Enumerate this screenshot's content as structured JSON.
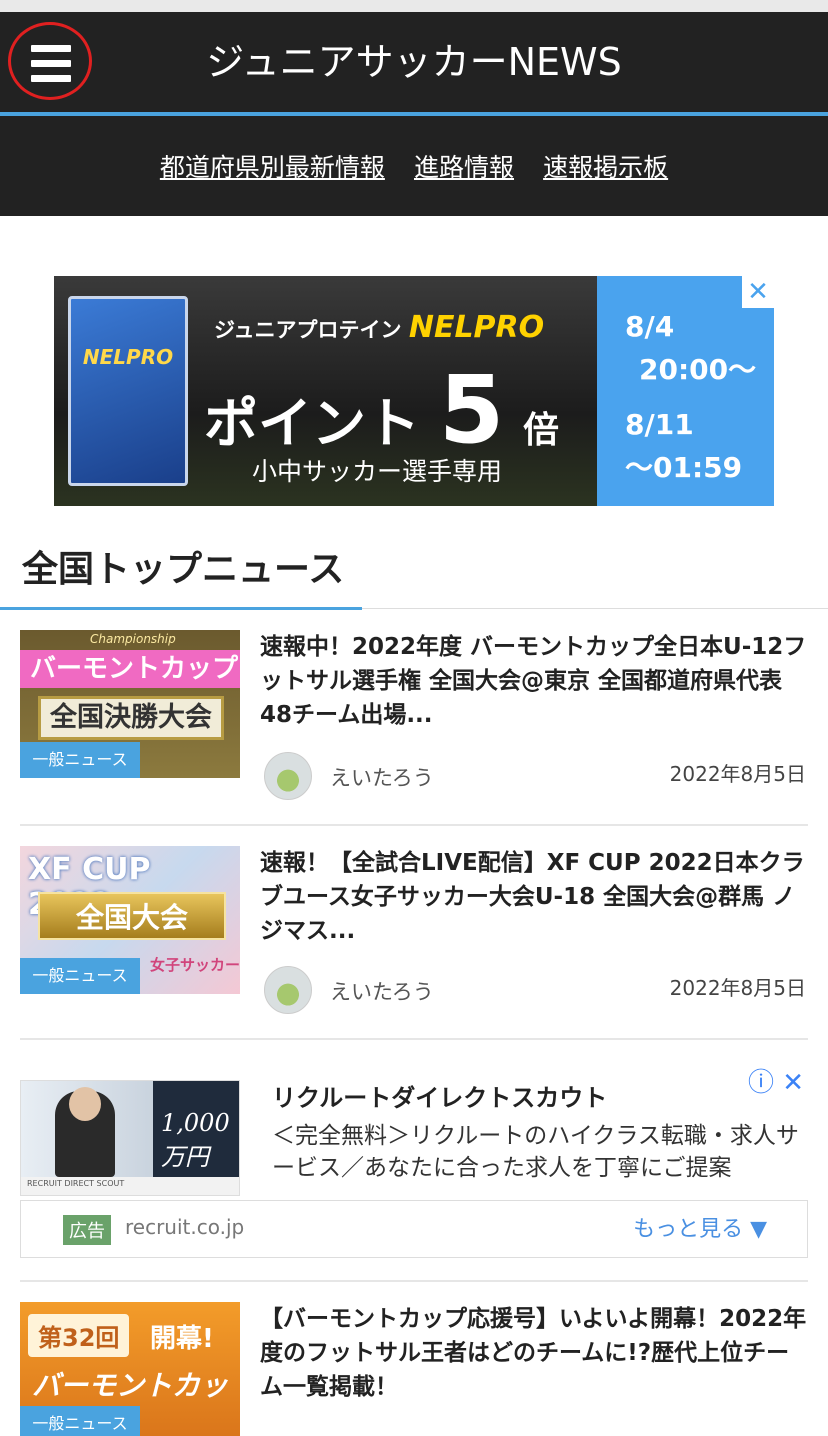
{
  "header": {
    "site_title": "ジュニアサッカーNEWS",
    "subnav": [
      "都道府県別最新情報",
      "進路情報",
      "速報掲示板"
    ]
  },
  "banner": {
    "line1": "ジュニアプロテイン",
    "brand": "NELPRO",
    "pkg_label": "NELPRO",
    "line2a": "ポイント",
    "line2b": "5",
    "line2c": "倍",
    "line3": "小中サッカー選手専用",
    "date1": "8/4",
    "time1": "20:00～",
    "date2": "8/11",
    "time2": "～01:59",
    "close": "✕"
  },
  "section": {
    "title": "全国トップニュース"
  },
  "articles": [
    {
      "title": "速報中！2022年度 バーモントカップ全日本U-12フットサル選手権 全国大会@東京 全国都道府県代表48チーム出場...",
      "tag": "一般ニュース",
      "author": "えいたろう",
      "date": "2022年8月5日",
      "thumb_pill": "バーモントカップ",
      "thumb_big": "全国決勝大会",
      "thumb_small": "Championship"
    },
    {
      "title": "速報！【全試合LIVE配信】XF CUP 2022日本クラブユース女子サッカー大会U-18 全国大会@群馬 ノジマス...",
      "tag": "一般ニュース",
      "author": "えいたろう",
      "date": "2022年8月5日",
      "thumb_cup": "XF CUP 2022",
      "thumb_gold": "全国大会",
      "thumb_pink": "女子サッカー"
    },
    {
      "title": "【バーモントカップ応援号】いよいよ開幕！2022年度のフットサル王者はどのチームに!?歴代上位チーム一覧掲載！",
      "tag": "一般ニュース",
      "thumb_n": "第32回",
      "thumb_open": "開幕!",
      "thumb_vm": "バーモントカップ"
    }
  ],
  "ad": {
    "title": "リクルートダイレクトスカウト",
    "description": "＜完全無料＞リクルートのハイクラス転職・求人サービス／あなたに合った求人を丁寧にご提案",
    "badge": "広告",
    "domain": "recruit.co.jp",
    "more": "もっと見る ▼",
    "icons": "ⓘ ✕",
    "thumb_salary": "1,000万円",
    "thumb_foot": "RECRUIT DIRECT SCOUT"
  }
}
